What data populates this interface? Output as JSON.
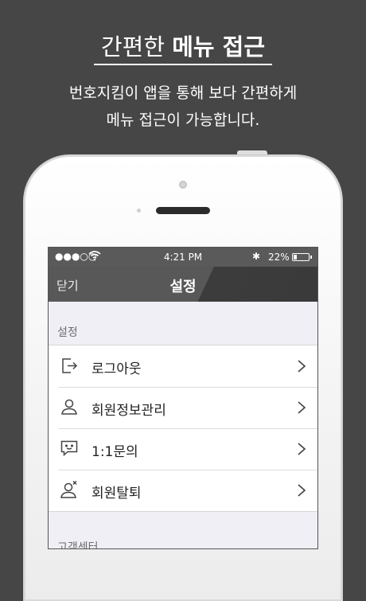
{
  "promo": {
    "headline_plain": "간편한 ",
    "headline_bold": "메뉴 접근",
    "subtitle_line1": "번호지킴이 앱을 통해 보다 간편하게",
    "subtitle_line2": "메뉴 접근이 가능합니다."
  },
  "status_bar": {
    "signal": "●●●○○",
    "time": "4:21 PM",
    "bluetooth": "✱",
    "battery_percent": "22%",
    "battery_level": 0.22
  },
  "nav": {
    "close_label": "닫기",
    "title": "설정"
  },
  "sections": [
    {
      "header": "설정",
      "items": [
        {
          "label": "로그아웃",
          "icon": "logout-icon"
        },
        {
          "label": "회원정보관리",
          "icon": "user-icon"
        },
        {
          "label": "1:1문의",
          "icon": "chat-icon"
        },
        {
          "label": "회원탈퇴",
          "icon": "user-remove-icon"
        }
      ]
    },
    {
      "header": "고객센터",
      "items": []
    }
  ],
  "colors": {
    "background": "#464646",
    "nav_bar": "#585858",
    "screen_bg": "#f0eff5"
  }
}
